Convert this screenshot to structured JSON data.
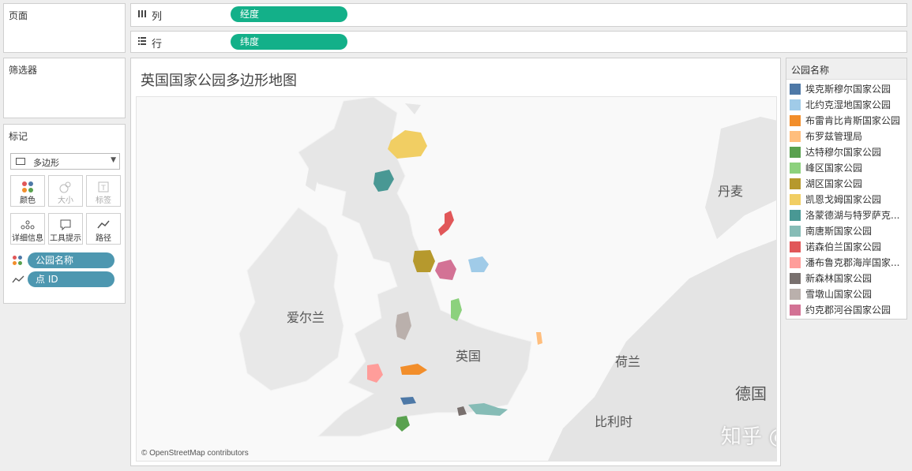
{
  "shelves": {
    "columns": {
      "label": "列",
      "pill": "经度"
    },
    "rows": {
      "label": "行",
      "pill": "纬度"
    }
  },
  "panels": {
    "pages": "页面",
    "filters": "筛选器",
    "marks": "标记"
  },
  "marks": {
    "type": "多边形",
    "buttons": {
      "color": "颜色",
      "size": "大小",
      "label": "标签",
      "detail": "详细信息",
      "tooltip": "工具提示",
      "path": "路径"
    },
    "pills": {
      "color_field": "公园名称",
      "path_field": "点 ID"
    }
  },
  "view": {
    "title": "英国国家公园多边形地图",
    "attribution": "© OpenStreetMap contributors"
  },
  "map_labels": {
    "uk": "英国",
    "ireland": "爱尔兰",
    "denmark": "丹麦",
    "netherlands": "荷兰",
    "belgium": "比利时",
    "germany": "德国"
  },
  "watermark": "知乎 @文武斌",
  "legend": {
    "title": "公园名称",
    "items": [
      {
        "label": "埃克斯穆尔国家公园",
        "color": "#4e79a7"
      },
      {
        "label": "北约克湿地国家公园",
        "color": "#a0cbe8"
      },
      {
        "label": "布雷肯比肯斯国家公园",
        "color": "#f28e2b"
      },
      {
        "label": "布罗兹管理局",
        "color": "#ffbe7d"
      },
      {
        "label": "达特穆尔国家公园",
        "color": "#59a14f"
      },
      {
        "label": "峰区国家公园",
        "color": "#8cd17d"
      },
      {
        "label": "湖区国家公园",
        "color": "#b6992d"
      },
      {
        "label": "凯恩戈姆国家公园",
        "color": "#f1ce63"
      },
      {
        "label": "洛蒙德湖与特罗萨克...",
        "color": "#499894"
      },
      {
        "label": "南唐斯国家公园",
        "color": "#86bcb6"
      },
      {
        "label": "诺森伯兰国家公园",
        "color": "#e15759"
      },
      {
        "label": "潘布鲁克郡海岸国家...",
        "color": "#ff9d9a"
      },
      {
        "label": "新森林国家公园",
        "color": "#79706e"
      },
      {
        "label": "雪墩山国家公园",
        "color": "#bab0ac"
      },
      {
        "label": "约克郡河谷国家公园",
        "color": "#d37295"
      }
    ]
  }
}
